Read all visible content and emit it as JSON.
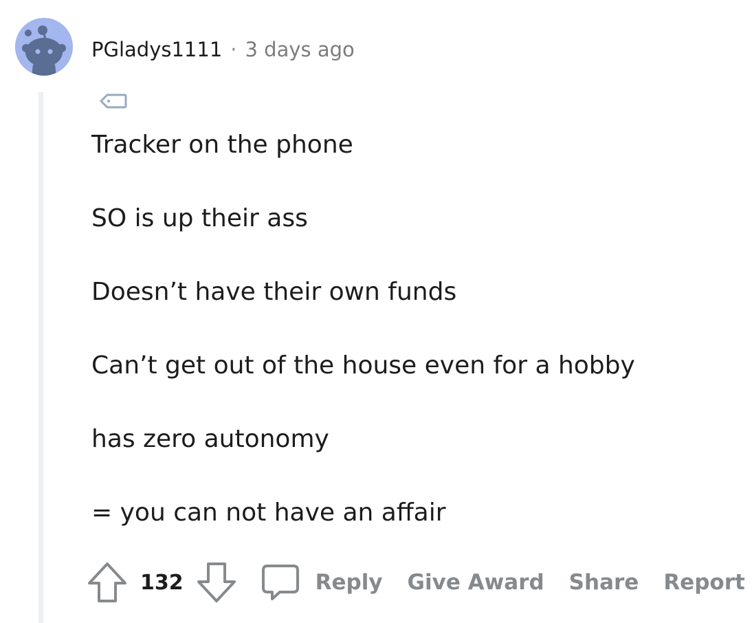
{
  "comment": {
    "author": "PGladys1111",
    "separator": "·",
    "timestamp": "3 days ago",
    "body_lines": [
      "Tracker on the phone",
      "SO is up their ass",
      "Doesn’t have their own funds",
      "Can’t get out of the house even for a hobby",
      "has zero autonomy",
      "= you can not have an affair"
    ]
  },
  "actions": {
    "vote_count": "132",
    "reply_label": "Reply",
    "give_award_label": "Give Award",
    "share_label": "Share",
    "report_label": "Report"
  },
  "icons": {
    "avatar": "snoo-avatar-icon",
    "flair": "tag-icon",
    "upvote": "arrow-up-icon",
    "downvote": "arrow-down-icon",
    "reply": "speech-bubble-icon"
  },
  "colors": {
    "avatar_bg": "#a3b6ee",
    "muted_text": "#878a8c",
    "body_text": "#1c1c1c",
    "thread_line": "#edeff1"
  }
}
